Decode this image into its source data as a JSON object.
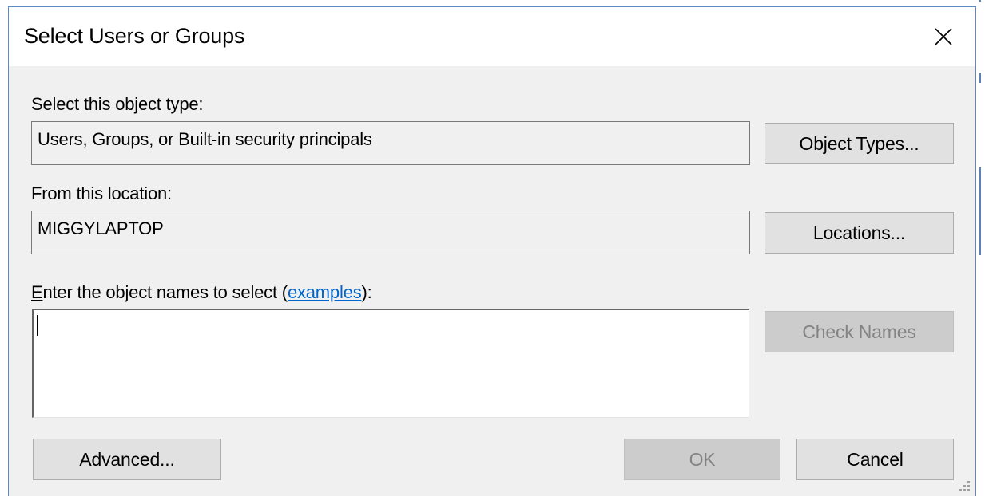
{
  "window": {
    "title": "Select Users or Groups",
    "close_icon": "close-icon"
  },
  "object_type": {
    "label": "Select this object type:",
    "value": "Users, Groups, or Built-in security principals",
    "button_label": "Object Types..."
  },
  "location": {
    "label": "From this location:",
    "value": "MIGGYLAPTOP",
    "button_label": "Locations..."
  },
  "names": {
    "label_access_key": "E",
    "label_rest": "nter the object names to select (",
    "link_text": "examples",
    "label_end": "):",
    "value": "",
    "check_names_label": "Check Names"
  },
  "footer": {
    "advanced_label": "Advanced...",
    "ok_label": "OK",
    "cancel_label": "Cancel"
  },
  "colors": {
    "accent_border": "#5b8ac4",
    "link": "#0066cc",
    "dialog_bg": "#f0f0f0",
    "disabled_text": "#838383"
  }
}
